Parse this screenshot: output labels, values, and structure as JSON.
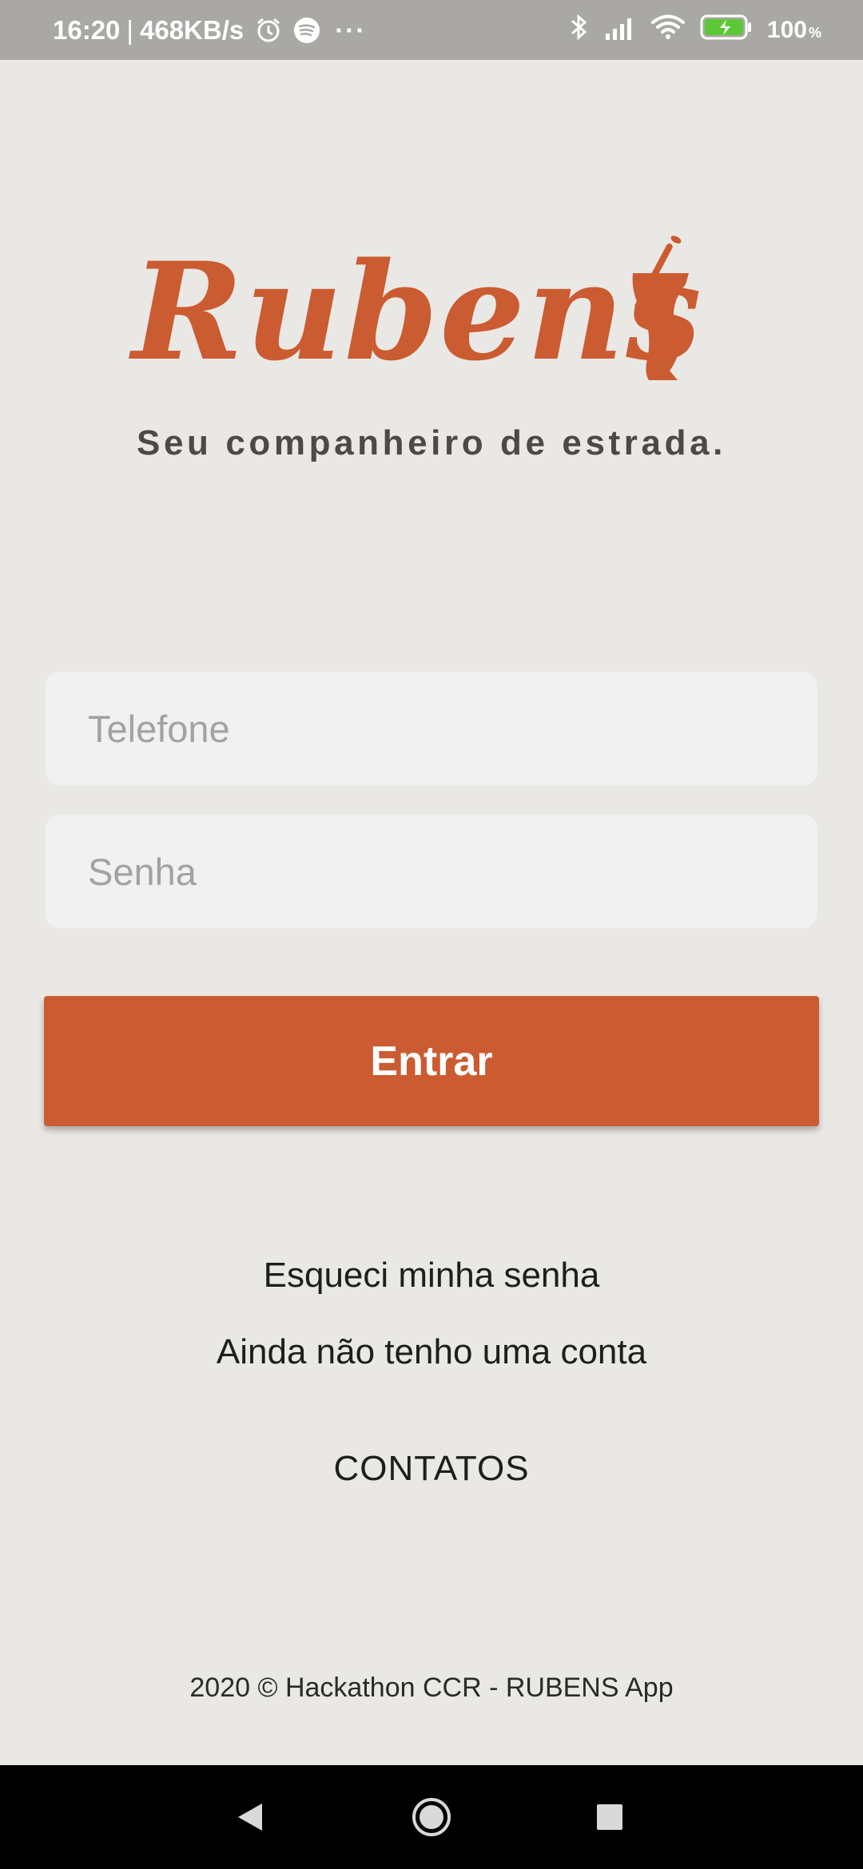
{
  "status_bar": {
    "time": "16:20",
    "separator": "|",
    "network_speed": "468KB/s",
    "more": "···",
    "battery_level": "100",
    "battery_unit": "%"
  },
  "brand": {
    "name": "Rubens",
    "tagline": "Seu companheiro de estrada.",
    "color": "#cb5b31"
  },
  "form": {
    "phone_placeholder": "Telefone",
    "password_placeholder": "Senha",
    "submit_label": "Entrar"
  },
  "links": {
    "forgot_password": "Esqueci minha senha",
    "no_account": "Ainda não tenho uma conta",
    "contacts": "CONTATOS"
  },
  "footer": {
    "text": "2020 © Hackathon CCR - RUBENS App"
  },
  "icons": [
    "alarm-icon",
    "spotify-icon",
    "bluetooth-icon",
    "signal-icon",
    "wifi-icon",
    "battery-icon",
    "back-icon",
    "home-icon",
    "recents-icon"
  ]
}
